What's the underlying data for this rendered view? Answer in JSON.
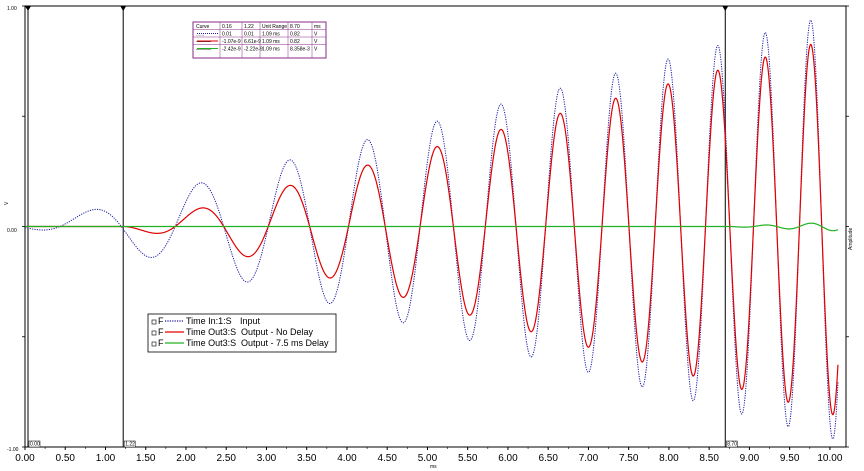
{
  "chart_data": {
    "type": "line",
    "xlabel": "ms",
    "ylabel_left": "V",
    "ylabel_right": "Amplitude",
    "xlim": [
      0,
      10.2
    ],
    "ylim": [
      -1.0,
      1.0
    ],
    "x_ticks": [
      0.0,
      0.5,
      1.0,
      1.5,
      2.0,
      2.5,
      3.0,
      3.5,
      4.0,
      4.5,
      5.0,
      5.5,
      6.0,
      6.5,
      7.0,
      7.5,
      8.0,
      8.5,
      9.0,
      9.5,
      10.0
    ],
    "x_tick_labels": [
      "0.00",
      "0.50",
      "1.00",
      "1.50",
      "2.00",
      "2.50",
      "3.00",
      "3.50",
      "4.00",
      "4.50",
      "5.00",
      "5.50",
      "6.00",
      "6.50",
      "7.00",
      "7.50",
      "8.00",
      "8.50",
      "9.00",
      "9.50",
      "10.00"
    ],
    "y_tick_labels": {
      "top": "1.00",
      "mid": "0.00",
      "bottom": "-1.00"
    },
    "cursors": [
      {
        "label": "0.00",
        "x": 0.0
      },
      {
        "label": "1.22",
        "x": 1.22
      },
      {
        "label": "8.70",
        "x": 8.7
      }
    ],
    "series": [
      {
        "name": "Input",
        "trace": "Time In:1:S",
        "flag": "F",
        "color": "#1a1aa6",
        "style": "dotted",
        "sweep": {
          "f0": 0.55,
          "f1": 1.85,
          "t0": 0.0,
          "t1": 10.1,
          "amp_start": 0.005,
          "amp_end": 0.97,
          "onset": 0.0
        }
      },
      {
        "name": "Output - No Delay",
        "trace": "Time Out3:S",
        "flag": "F",
        "color": "#e00000",
        "style": "solid",
        "sweep": {
          "f0": 0.55,
          "f1": 1.85,
          "t0": 0.0,
          "t1": 10.1,
          "amp_start": 0.0,
          "amp_end": 0.86,
          "onset": 1.22
        }
      },
      {
        "name": "Output - 7.5 ms Delay",
        "trace": "Time Out3:S",
        "flag": "F",
        "color": "#22b022",
        "style": "solid",
        "sweep": {
          "f0": 0.55,
          "f1": 1.85,
          "t0": 0.0,
          "t1": 10.1,
          "amp_start": 0.0,
          "amp_end": 0.02,
          "onset": 8.7
        }
      }
    ],
    "table": {
      "headers": [
        "Curve",
        "0.16",
        "1.22",
        "Unit Range",
        "8.70",
        "ms"
      ],
      "rows": [
        [
          "......",
          "0.01",
          "0.01",
          "1.09  ms",
          "0.82",
          "V"
        ],
        [
          "———",
          "-1.07e-9",
          "6.61e-9",
          "1.09  ms",
          "0.82",
          "V"
        ],
        [
          "———",
          "-2.42e-9",
          "-2.22e-9",
          "1.09  ms",
          "8.358e-3",
          "V"
        ]
      ]
    }
  }
}
